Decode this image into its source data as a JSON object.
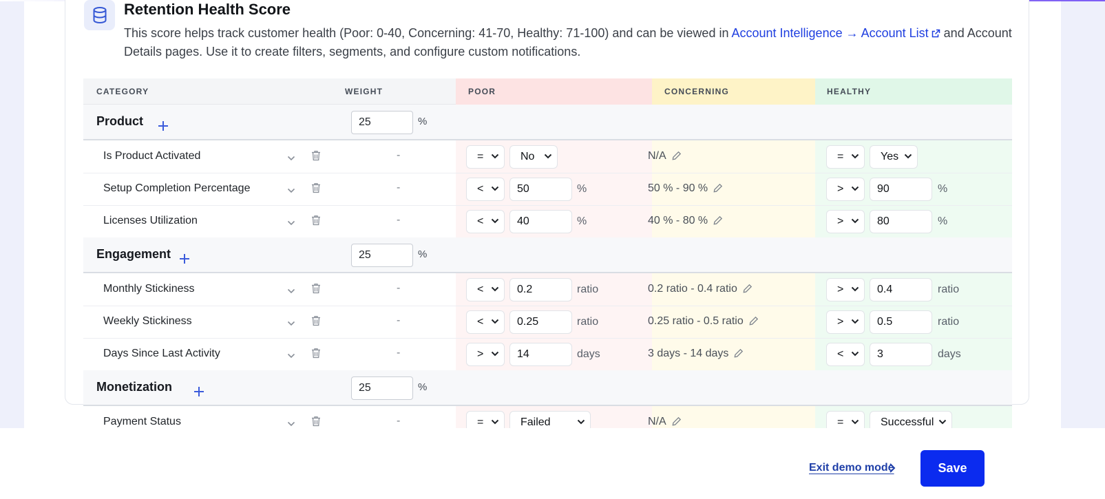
{
  "header": {
    "title": "Retention Health Score",
    "description_prefix": "This score helps track customer health (Poor: 0-40, Concerning: 41-70, Healthy: 71-100) and can be viewed in",
    "link_text": "Account Intelligence → Account List",
    "description_suffix": "and Account Details pages. Use it to create filters, segments, and configure custom notifications.",
    "icon": "database-icon"
  },
  "table": {
    "columns": {
      "category": "CATEGORY",
      "weight": "WEIGHT",
      "poor": "POOR",
      "concerning": "CONCERNING",
      "healthy": "HEALTHY"
    },
    "categories": [
      {
        "name": "Product",
        "weight": "25",
        "weight_unit": "%",
        "metrics": [
          {
            "name": "Is Product Activated",
            "weight": "-",
            "poor_op": "=",
            "poor_value": "No",
            "poor_unit": "",
            "concerning": "N/A",
            "healthy_op": "=",
            "healthy_value": "Yes",
            "healthy_unit": ""
          },
          {
            "name": "Setup Completion Percentage",
            "weight": "-",
            "poor_op": "<",
            "poor_value": "50",
            "poor_unit": "%",
            "concerning": "50 % - 90 %",
            "healthy_op": ">",
            "healthy_value": "90",
            "healthy_unit": "%"
          },
          {
            "name": "Licenses Utilization",
            "weight": "-",
            "poor_op": "<",
            "poor_value": "40",
            "poor_unit": "%",
            "concerning": "40 % - 80 %",
            "healthy_op": ">",
            "healthy_value": "80",
            "healthy_unit": "%"
          }
        ]
      },
      {
        "name": "Engagement",
        "weight": "25",
        "weight_unit": "%",
        "metrics": [
          {
            "name": "Monthly Stickiness",
            "weight": "-",
            "poor_op": "<",
            "poor_value": "0.2",
            "poor_unit": "ratio",
            "concerning": "0.2 ratio - 0.4 ratio",
            "healthy_op": ">",
            "healthy_value": "0.4",
            "healthy_unit": "ratio"
          },
          {
            "name": "Weekly Stickiness",
            "weight": "-",
            "poor_op": "<",
            "poor_value": "0.25",
            "poor_unit": "ratio",
            "concerning": "0.25 ratio - 0.5 ratio",
            "healthy_op": ">",
            "healthy_value": "0.5",
            "healthy_unit": "ratio"
          },
          {
            "name": "Days Since Last Activity",
            "weight": "-",
            "poor_op": ">",
            "poor_value": "14",
            "poor_unit": "days",
            "concerning": "3 days - 14 days",
            "healthy_op": "<",
            "healthy_value": "3",
            "healthy_unit": "days"
          }
        ]
      },
      {
        "name": "Monetization",
        "weight": "25",
        "weight_unit": "%",
        "metrics": [
          {
            "name": "Payment Status",
            "weight": "-",
            "poor_op": "=",
            "poor_value": "Failed",
            "poor_unit": "",
            "concerning": "N/A",
            "healthy_op": "=",
            "healthy_value": "Successful",
            "healthy_unit": ""
          }
        ]
      }
    ]
  },
  "footer": {
    "exit_label": "Exit demo mode",
    "save_label": "Save"
  },
  "colors": {
    "accent": "#0b2bef",
    "link": "#1f3fe0",
    "poor_header": "#fde3e3",
    "concerning_header": "#fef3c7",
    "healthy_header": "#e0f7e8"
  }
}
